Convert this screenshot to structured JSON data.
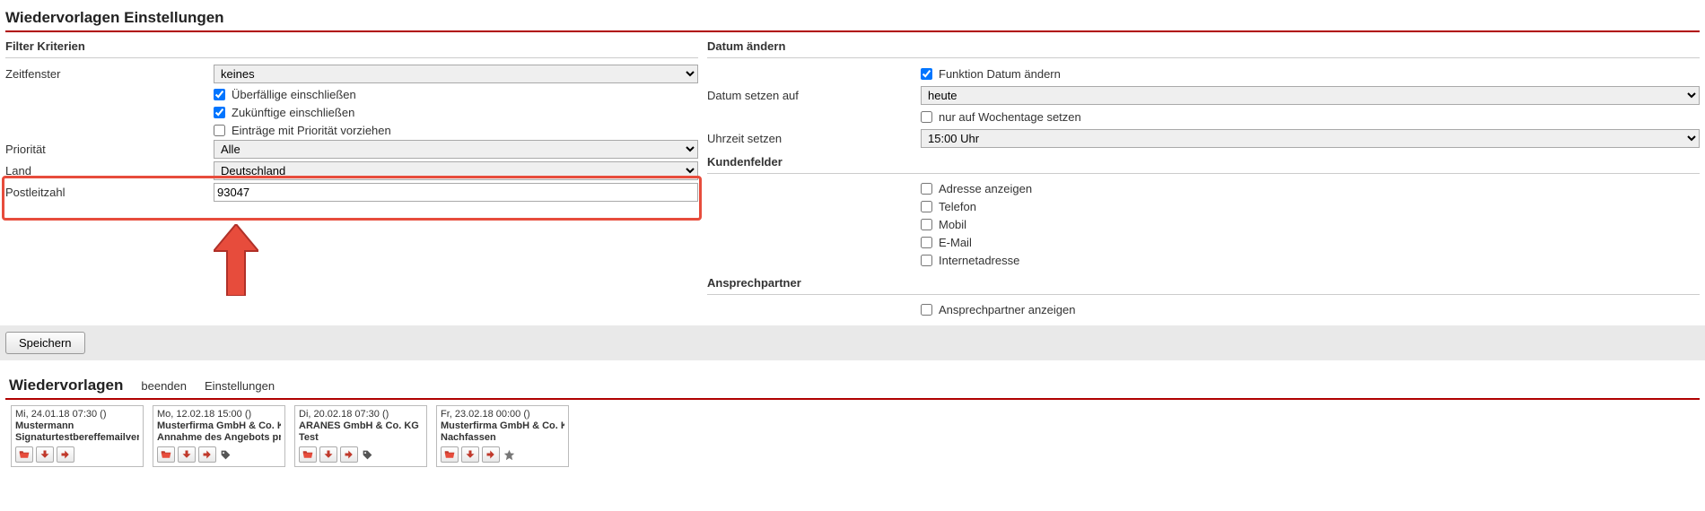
{
  "page": {
    "title": "Wiedervorlagen Einstellungen"
  },
  "filter": {
    "title": "Filter Kriterien",
    "zeitfenster_label": "Zeitfenster",
    "zeitfenster_value": "keines",
    "ueberfaellige_label": "Überfällige einschließen",
    "zukuenftige_label": "Zukünftige einschließen",
    "prioritaet_vorziehen_label": "Einträge mit Priorität vorziehen",
    "prioritaet_label": "Priorität",
    "prioritaet_value": "Alle",
    "land_label": "Land",
    "land_value": "Deutschland",
    "plz_label": "Postleitzahl",
    "plz_value": "93047"
  },
  "datum": {
    "title": "Datum ändern",
    "funktion_label": "Funktion Datum ändern",
    "datum_setzen_label": "Datum setzen auf",
    "datum_setzen_value": "heute",
    "wochentage_label": "nur auf Wochentage setzen",
    "uhrzeit_label": "Uhrzeit setzen",
    "uhrzeit_value": "15:00 Uhr"
  },
  "kundenfelder": {
    "title": "Kundenfelder",
    "adresse": "Adresse anzeigen",
    "telefon": "Telefon",
    "mobil": "Mobil",
    "email": "E-Mail",
    "internet": "Internetadresse"
  },
  "ansprechpartner": {
    "title": "Ansprechpartner",
    "anzeigen": "Ansprechpartner anzeigen"
  },
  "save": {
    "label": "Speichern"
  },
  "wv": {
    "title": "Wiedervorlagen",
    "beenden": "beenden",
    "einstellungen": "Einstellungen"
  },
  "cards": [
    {
      "date": "Mi, 24.01.18 07:30 ()",
      "company": "Mustermann",
      "subject": "Signaturtestbereffemailversand",
      "extra_icons": []
    },
    {
      "date": "Mo, 12.02.18 15:00 ()",
      "company": "Musterfirma GmbH & Co. KG",
      "subject": "Annahme des Angebots prüfen",
      "extra_icons": [
        "tag"
      ]
    },
    {
      "date": "Di, 20.02.18 07:30 ()",
      "company": "ARANES GmbH & Co. KG",
      "subject": "Test",
      "extra_icons": [
        "tag"
      ]
    },
    {
      "date": "Fr, 23.02.18 00:00 ()",
      "company": "Musterfirma GmbH & Co. KG",
      "subject": "Nachfassen",
      "extra_icons": [
        "star"
      ]
    }
  ]
}
